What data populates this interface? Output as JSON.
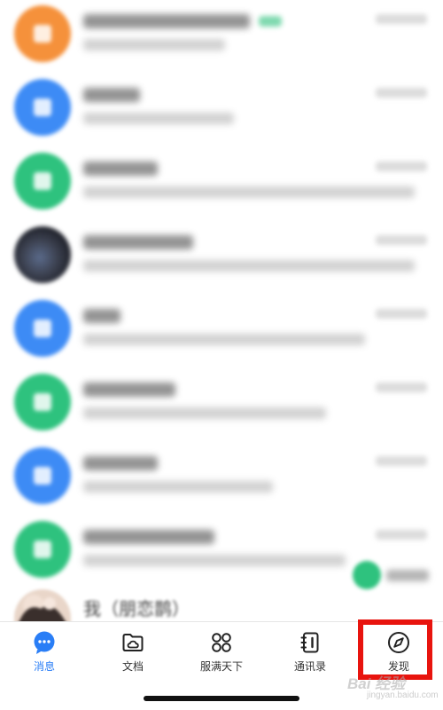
{
  "colors": {
    "accent": "#2a7ef6",
    "highlight": "#e8140e",
    "tab_text": "#333333",
    "avatar_orange": "#f5913b",
    "avatar_blue": "#3d8bf5",
    "avatar_green": "#2ec27e",
    "avatar_dark": "#3c4150"
  },
  "message_list": {
    "items": [
      {
        "avatar_color": "#f5913b",
        "avatar_kind": "app-icon"
      },
      {
        "avatar_color": "#3d8bf5",
        "avatar_kind": "app-icon"
      },
      {
        "avatar_color": "#2ec27e",
        "avatar_kind": "app-icon"
      },
      {
        "avatar_color": "#3c4150",
        "avatar_kind": "photo"
      },
      {
        "avatar_color": "#3d8bf5",
        "avatar_kind": "app-icon"
      },
      {
        "avatar_color": "#2ec27e",
        "avatar_kind": "app-icon"
      },
      {
        "avatar_color": "#3d8bf5",
        "avatar_kind": "app-icon"
      },
      {
        "avatar_color": "#2ec27e",
        "avatar_kind": "app-icon"
      }
    ],
    "partial_row_text": "我（朋恋鹊）"
  },
  "tab_bar": {
    "tabs": [
      {
        "id": "messages",
        "label": "消息",
        "icon": "chat-bubble-icon",
        "active": true
      },
      {
        "id": "docs",
        "label": "文档",
        "icon": "folder-cloud-icon",
        "active": false
      },
      {
        "id": "apps",
        "label": "服满天下",
        "icon": "grid-apps-icon",
        "active": false
      },
      {
        "id": "contacts",
        "label": "通讯录",
        "icon": "address-book-icon",
        "active": false
      },
      {
        "id": "discover",
        "label": "发现",
        "icon": "compass-icon",
        "active": false
      }
    ],
    "highlighted_tab": "discover"
  },
  "watermark": {
    "main": "Bai 经验",
    "sub": "jingyan.baidu.com"
  }
}
